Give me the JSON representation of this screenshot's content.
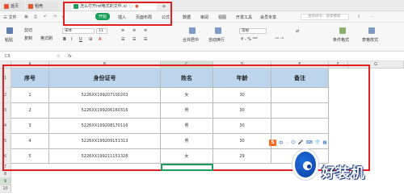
{
  "tabs": {
    "home": "首页",
    "docer": "稻壳",
    "file": "怎么打开ref格式的文件.xl",
    "add": "+"
  },
  "menu": {
    "items": [
      "三 文件",
      "开始",
      "插入",
      "页面布局",
      "公式",
      "数据",
      "审阅",
      "视图",
      "开发工具",
      "会员专享"
    ],
    "search_placeholder": "查找命令、搜索模板"
  },
  "ribbon": {
    "paste": "粘贴",
    "cut": "剪切",
    "copy": "复制",
    "format_painter": "格式刷",
    "font": "宋体",
    "font_size": "11",
    "merge_center": "合并居中",
    "wrap": "自动换行",
    "number_format": "常规",
    "conditional_format": "条件格式",
    "table_style": "表格样式"
  },
  "formula": {
    "name_box": "C9",
    "fx": "fx"
  },
  "columns": [
    "A",
    "B",
    "C",
    "D",
    "E",
    "F",
    "G"
  ],
  "rows": [
    "1",
    "2",
    "3",
    "4",
    "5",
    "6",
    "7",
    "8",
    "9",
    "10"
  ],
  "table": {
    "headers": [
      "序号",
      "身份证号",
      "姓名",
      "年龄",
      "备注"
    ],
    "rows": [
      [
        "1",
        "5226XX199207100203",
        "女",
        "30",
        ""
      ],
      [
        "2",
        "5226XX199206160316",
        "男",
        "30",
        ""
      ],
      [
        "3",
        "5226XX199208170116",
        "男",
        "30",
        ""
      ],
      [
        "4",
        "5226XX199209151313",
        "男",
        "30",
        ""
      ],
      [
        "5",
        "5226XX199211151328",
        "女",
        "29",
        ""
      ]
    ]
  },
  "ime": {
    "logo": "S",
    "items": [
      "中",
      "·,",
      "☺",
      "🎤",
      "⌨",
      "👕",
      "▦"
    ]
  },
  "watermark": {
    "text": "好装机"
  },
  "colors": {
    "accent_green": "#1a9e5c",
    "annotation_red": "#e02020",
    "header_fill": "#bcd4ec"
  }
}
